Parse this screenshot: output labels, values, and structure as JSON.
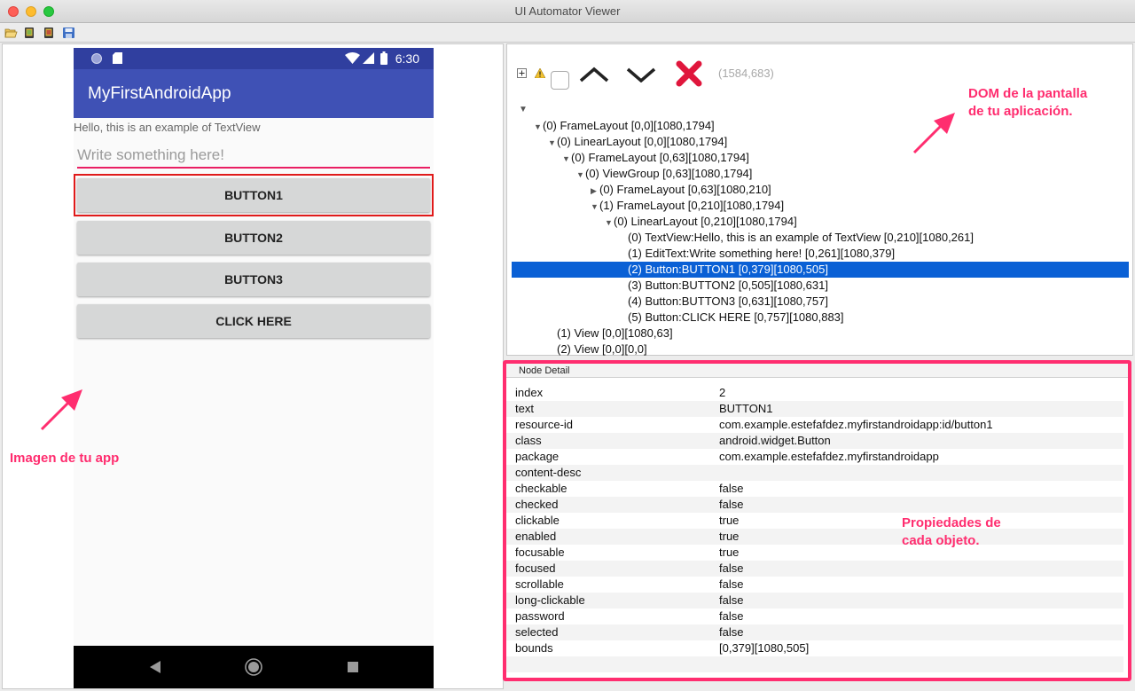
{
  "window": {
    "title": "UI Automator Viewer"
  },
  "device": {
    "status_time": "6:30",
    "app_title": "MyFirstAndroidApp",
    "textview": "Hello, this is an example of TextView",
    "edit_placeholder": "Write something here!",
    "buttons": [
      "BUTTON1",
      "BUTTON2",
      "BUTTON3",
      "CLICK HERE"
    ]
  },
  "annotations": {
    "app_image": "Imagen de tu app",
    "dom_line1": "DOM de la pantalla",
    "dom_line2": "de tu aplicación.",
    "props_line1": "Propiedades de",
    "props_line2": "cada objeto."
  },
  "hierarchy": {
    "coords": "(1584,683)",
    "nodes": [
      {
        "text": "(0) FrameLayout [0,0][1080,1794]",
        "state": "open"
      },
      {
        "text": "(0) LinearLayout [0,0][1080,1794]",
        "state": "open"
      },
      {
        "text": "(0) FrameLayout [0,63][1080,1794]",
        "state": "open"
      },
      {
        "text": "(0) ViewGroup [0,63][1080,1794]",
        "state": "open"
      },
      {
        "text": "(0) FrameLayout [0,63][1080,210]",
        "state": "closed"
      },
      {
        "text": "(1) FrameLayout [0,210][1080,1794]",
        "state": "open"
      },
      {
        "text": "(0) LinearLayout [0,210][1080,1794]",
        "state": "open"
      },
      {
        "text": "(0) TextView:Hello, this is an example of TextView [0,210][1080,261]",
        "state": "leaf"
      },
      {
        "text": "(1) EditText:Write something here! [0,261][1080,379]",
        "state": "leaf"
      },
      {
        "text": "(2) Button:BUTTON1 [0,379][1080,505]",
        "state": "leaf",
        "selected": true
      },
      {
        "text": "(3) Button:BUTTON2 [0,505][1080,631]",
        "state": "leaf"
      },
      {
        "text": "(4) Button:BUTTON3 [0,631][1080,757]",
        "state": "leaf"
      },
      {
        "text": "(5) Button:CLICK HERE [0,757][1080,883]",
        "state": "leaf"
      },
      {
        "text": "(1) View [0,0][1080,63]",
        "state": "leaf"
      },
      {
        "text": "(2) View [0,0][0,0]",
        "state": "leaf"
      }
    ]
  },
  "node_detail": {
    "title": "Node Detail",
    "rows": [
      {
        "k": "index",
        "v": "2"
      },
      {
        "k": "text",
        "v": "BUTTON1"
      },
      {
        "k": "resource-id",
        "v": "com.example.estefafdez.myfirstandroidapp:id/button1"
      },
      {
        "k": "class",
        "v": "android.widget.Button"
      },
      {
        "k": "package",
        "v": "com.example.estefafdez.myfirstandroidapp"
      },
      {
        "k": "content-desc",
        "v": ""
      },
      {
        "k": "checkable",
        "v": "false"
      },
      {
        "k": "checked",
        "v": "false"
      },
      {
        "k": "clickable",
        "v": "true"
      },
      {
        "k": "enabled",
        "v": "true"
      },
      {
        "k": "focusable",
        "v": "true"
      },
      {
        "k": "focused",
        "v": "false"
      },
      {
        "k": "scrollable",
        "v": "false"
      },
      {
        "k": "long-clickable",
        "v": "false"
      },
      {
        "k": "password",
        "v": "false"
      },
      {
        "k": "selected",
        "v": "false"
      },
      {
        "k": "bounds",
        "v": "[0,379][1080,505]"
      }
    ]
  }
}
